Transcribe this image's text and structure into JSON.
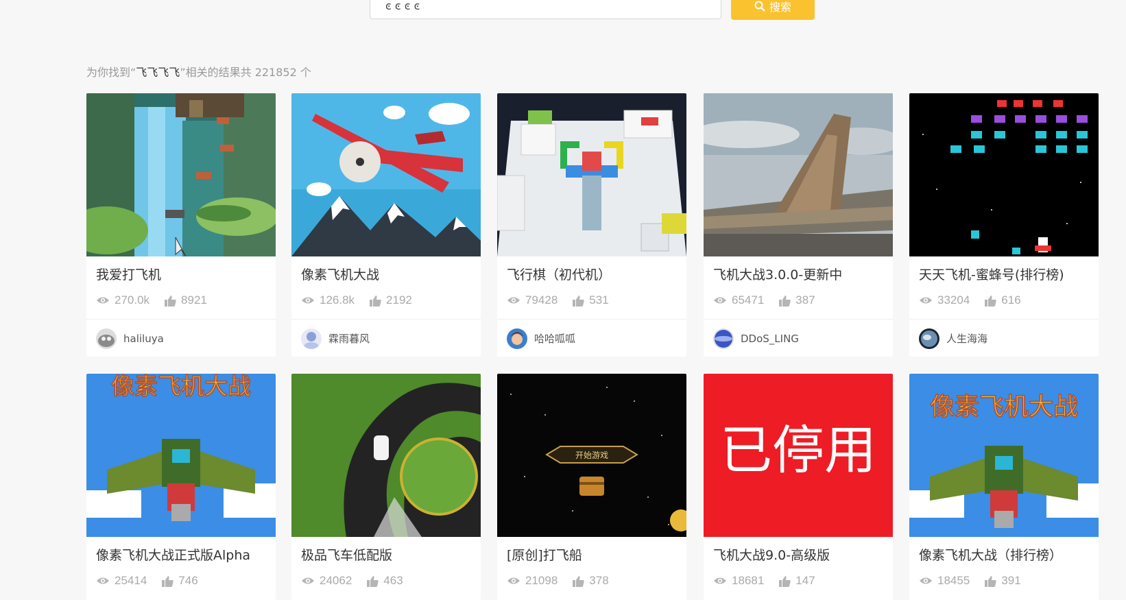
{
  "search": {
    "value": "ͼ ͼ ͼ ͼ",
    "button_label": "搜索"
  },
  "summary": {
    "prefix": "为你找到“",
    "keyword": "飞飞飞飞",
    "suffix": "”相关的结果共 221852 个"
  },
  "colors": {
    "accent": "#fbc22f",
    "stat_gray": "#aaaaaa",
    "disabled_red": "#ee1c25"
  },
  "cards": [
    {
      "title": "我爱打飞机",
      "views": "270.0k",
      "likes": "8921",
      "author": "haliluya",
      "icon": "waterfall-shooter-thumbnail"
    },
    {
      "title": "像素飞机大战",
      "views": "126.8k",
      "likes": "2192",
      "author": "霖雨暮风",
      "icon": "red-biplane-thumbnail"
    },
    {
      "title": "飞行棋（初代机）",
      "views": "79428",
      "likes": "531",
      "author": "哈哈呱呱",
      "icon": "ludo-board-thumbnail"
    },
    {
      "title": "飞机大战3.0.0-更新中",
      "views": "65471",
      "likes": "387",
      "author": "DDoS_LING",
      "icon": "fighter-jet-thumbnail"
    },
    {
      "title": "天天飞机-蜜蜂号(排行榜)",
      "views": "33204",
      "likes": "616",
      "author": "人生海海",
      "icon": "space-invaders-thumbnail"
    },
    {
      "title": "像素飞机大战正式版Alpha",
      "views": "25414",
      "likes": "746",
      "icon": "pixel-plane-thumbnail",
      "banner": "像素飞机大战"
    },
    {
      "title": "极品飞车低配版",
      "views": "24062",
      "likes": "463",
      "icon": "race-track-thumbnail"
    },
    {
      "title": "[原创]打飞船",
      "views": "21098",
      "likes": "378",
      "icon": "starfield-thumbnail",
      "start_label": "开始游戏"
    },
    {
      "title": "飞机大战9.0-高级版",
      "views": "18681",
      "likes": "147",
      "icon": "disabled-thumbnail",
      "disabled_label": "已停用"
    },
    {
      "title": "像素飞机大战（排行榜）",
      "views": "18455",
      "likes": "391",
      "icon": "pixel-plane-thumbnail",
      "banner": "像素飞机大战"
    }
  ]
}
